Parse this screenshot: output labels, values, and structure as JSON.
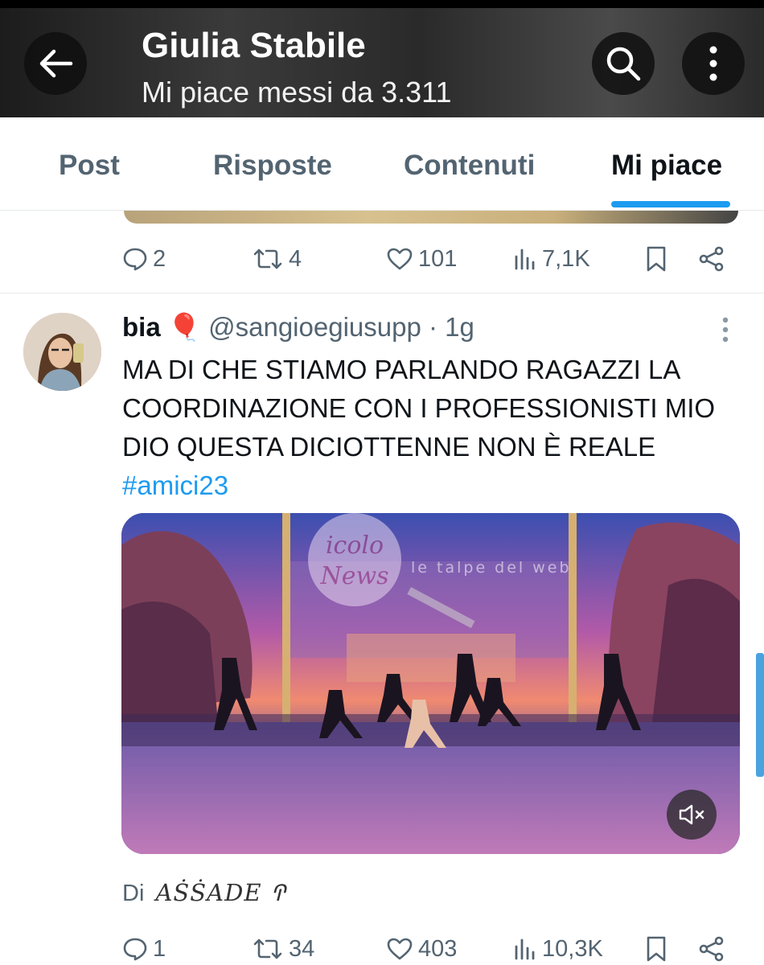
{
  "header": {
    "title": "Giulia Stabile",
    "subtitle": "Mi piace messi da 3.311"
  },
  "tabs": [
    {
      "label": "Post",
      "active": false
    },
    {
      "label": "Risposte",
      "active": false
    },
    {
      "label": "Contenuti",
      "active": false
    },
    {
      "label": "Mi piace",
      "active": true
    }
  ],
  "previous_tweet": {
    "replies": "2",
    "reposts": "4",
    "likes": "101",
    "views": "7,1K"
  },
  "tweet": {
    "name": "bia",
    "name_emoji": "🎈",
    "handle": "@sangioegiusupp",
    "time": "· 1g",
    "text": "MA DI CHE STIAMO PARLANDO RAGAZZI LA COORDINAZIONE CON I PROFESSIONISTI MIO DIO QUESTA DICIOTTENNE NON È REALE",
    "hashtag": "#amici23",
    "media": {
      "watermark_1": "icolo delle News",
      "watermark_2": "le talpe del web"
    },
    "byline_prefix": "Di",
    "byline_sig": "AṠṠADE ꛈ",
    "replies": "1",
    "reposts": "34",
    "likes": "403",
    "views": "10,3K"
  },
  "colors": {
    "accent": "#1d9bf0",
    "muted": "#536471",
    "text": "#0f1419"
  }
}
